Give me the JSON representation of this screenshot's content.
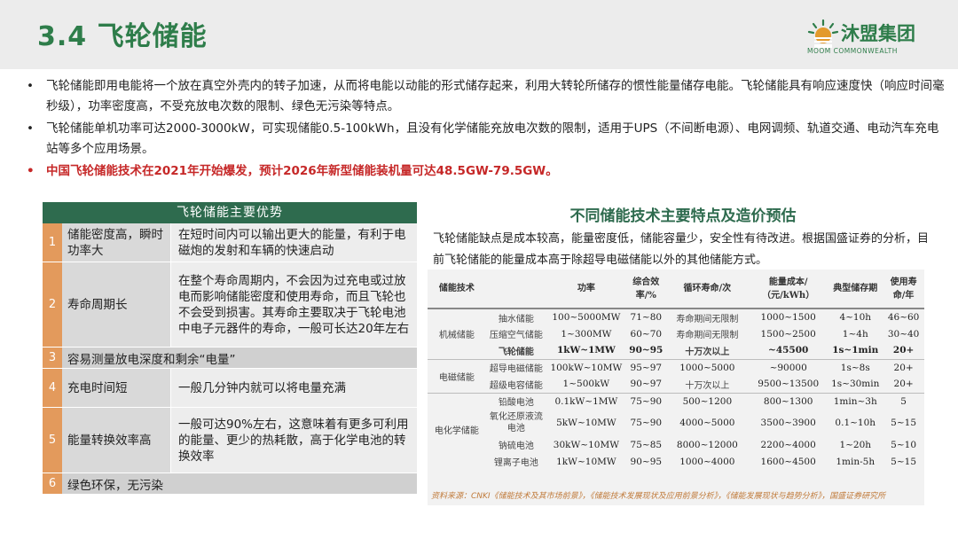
{
  "header": {
    "title": "3.4  飞轮储能",
    "logo_name": "沐盟集团",
    "logo_sub": "MOOM COMMONWEALTH",
    "brand_color": "#2e7d4a"
  },
  "bullets": [
    {
      "dot": "•",
      "text": "飞轮储能即用电能将一个放在真空外壳内的转子加速，从而将电能以动能的形式储存起来，利用大转轮所储存的惯性能量储存电能。飞轮储能具有响应速度快（响应时间毫秒级），功率密度高，不受充放电次数的限制、绿色无污染等特点。"
    },
    {
      "dot": "•",
      "text": "飞轮储能单机功率可达2000-3000kW，可实现储能0.5-100kWh，且没有化学储能充放电次数的限制，适用于UPS（不间断电源）、电网调频、轨道交通、电动汽车充电站等多个应用场景。"
    },
    {
      "dot": "•",
      "text": "中国飞轮储能技术在2021年开始爆发，预计2026年新型储能装机量可达48.5GW-79.5GW。"
    }
  ],
  "advantages": {
    "title": "飞轮储能主要优势",
    "rows": [
      {
        "num": "1",
        "name": "储能密度高，瞬时功率大",
        "desc": "在短时间内可以输出更大的能量，有利于电磁炮的发射和车辆的快速启动"
      },
      {
        "num": "2",
        "name": "寿命周期长",
        "desc": "在整个寿命周期内，不会因为过充电或过放电而影响储能密度和使用寿命，而且飞轮也不会受到损害。其寿命主要取决于飞轮电池中电子元器件的寿命，一般可长达20年左右"
      },
      {
        "num": "3",
        "full": "容易测量放电深度和剩余“电量”"
      },
      {
        "num": "4",
        "name": "充电时间短",
        "desc": "一般几分钟内就可以将电量充满"
      },
      {
        "num": "5",
        "name": "能量转换效率高",
        "desc": "一般可达90%左右，这意味着有更多可利用的能量、更少的热耗散，高于化学电池的转换效率"
      },
      {
        "num": "6",
        "full": "绿色环保，无污染"
      }
    ]
  },
  "comparison": {
    "title": "不同储能技术主要特点及造价预估",
    "note": "飞轮储能缺点是成本较高，能量密度低，储能容量少，安全性有待改进。根据国盛证券的分析，目前飞轮储能的能量成本高于除超导电磁储能以外的其他储能方式。",
    "headers": [
      "储能技术",
      "",
      "功率",
      "综合效率/%",
      "循环寿命/次",
      "能量成本/（元/kWh）",
      "典型储存期",
      "使用寿命/年"
    ],
    "groups": [
      {
        "category": "机械储能",
        "rows": [
          {
            "tech": "抽水储能",
            "power": "100~5000MW",
            "eff": "71~80",
            "cycle": "寿命期间无限制",
            "cost": "1000~1500",
            "period": "4~10h",
            "life": "46~60"
          },
          {
            "tech": "压缩空气储能",
            "power": "1~300MW",
            "eff": "60~70",
            "cycle": "寿命期间无限制",
            "cost": "1500~2500",
            "period": "1~4h",
            "life": "30~40"
          },
          {
            "tech": "飞轮储能",
            "power": "1kW~1MW",
            "eff": "90~95",
            "cycle": "十万次以上",
            "cost": "~45500",
            "period": "1s~1min",
            "life": "20+",
            "bold": true
          }
        ]
      },
      {
        "category": "电磁储能",
        "rows": [
          {
            "tech": "超导电磁储能",
            "power": "100kW~10MW",
            "eff": "95~97",
            "cycle": "1000~5000",
            "cost": "~90000",
            "period": "1s~8s",
            "life": "20+"
          },
          {
            "tech": "超级电容储能",
            "power": "1~500kW",
            "eff": "90~97",
            "cycle": "十万次以上",
            "cost": "9500~13500",
            "period": "1s~30min",
            "life": "20+"
          }
        ]
      },
      {
        "category": "电化学储能",
        "rows": [
          {
            "tech": "铅酸电池",
            "power": "0.1kW~1MW",
            "eff": "75~90",
            "cycle": "500~1200",
            "cost": "800~1300",
            "period": "1min~3h",
            "life": "5"
          },
          {
            "tech": "氧化还原液流电池",
            "power": "5kW~10MW",
            "eff": "75~90",
            "cycle": "4000~5000",
            "cost": "3500~3900",
            "period": "0.1~10h",
            "life": "5~15"
          },
          {
            "tech": "钠硫电池",
            "power": "30kW~10MW",
            "eff": "75~85",
            "cycle": "8000~12000",
            "cost": "2200~4000",
            "period": "1~20h",
            "life": "5~10"
          },
          {
            "tech": "锂离子电池",
            "power": "1kW~10MW",
            "eff": "90~95",
            "cycle": "1000~4000",
            "cost": "1600~4500",
            "period": "1min-5h",
            "life": "5~15"
          }
        ]
      }
    ],
    "source": "资料来源：CNKI《储能技术及其市场前景》，《储能技术发展现状及应用前景分析》，《储能发展现状与趋势分析》，国盛证券研究所"
  }
}
